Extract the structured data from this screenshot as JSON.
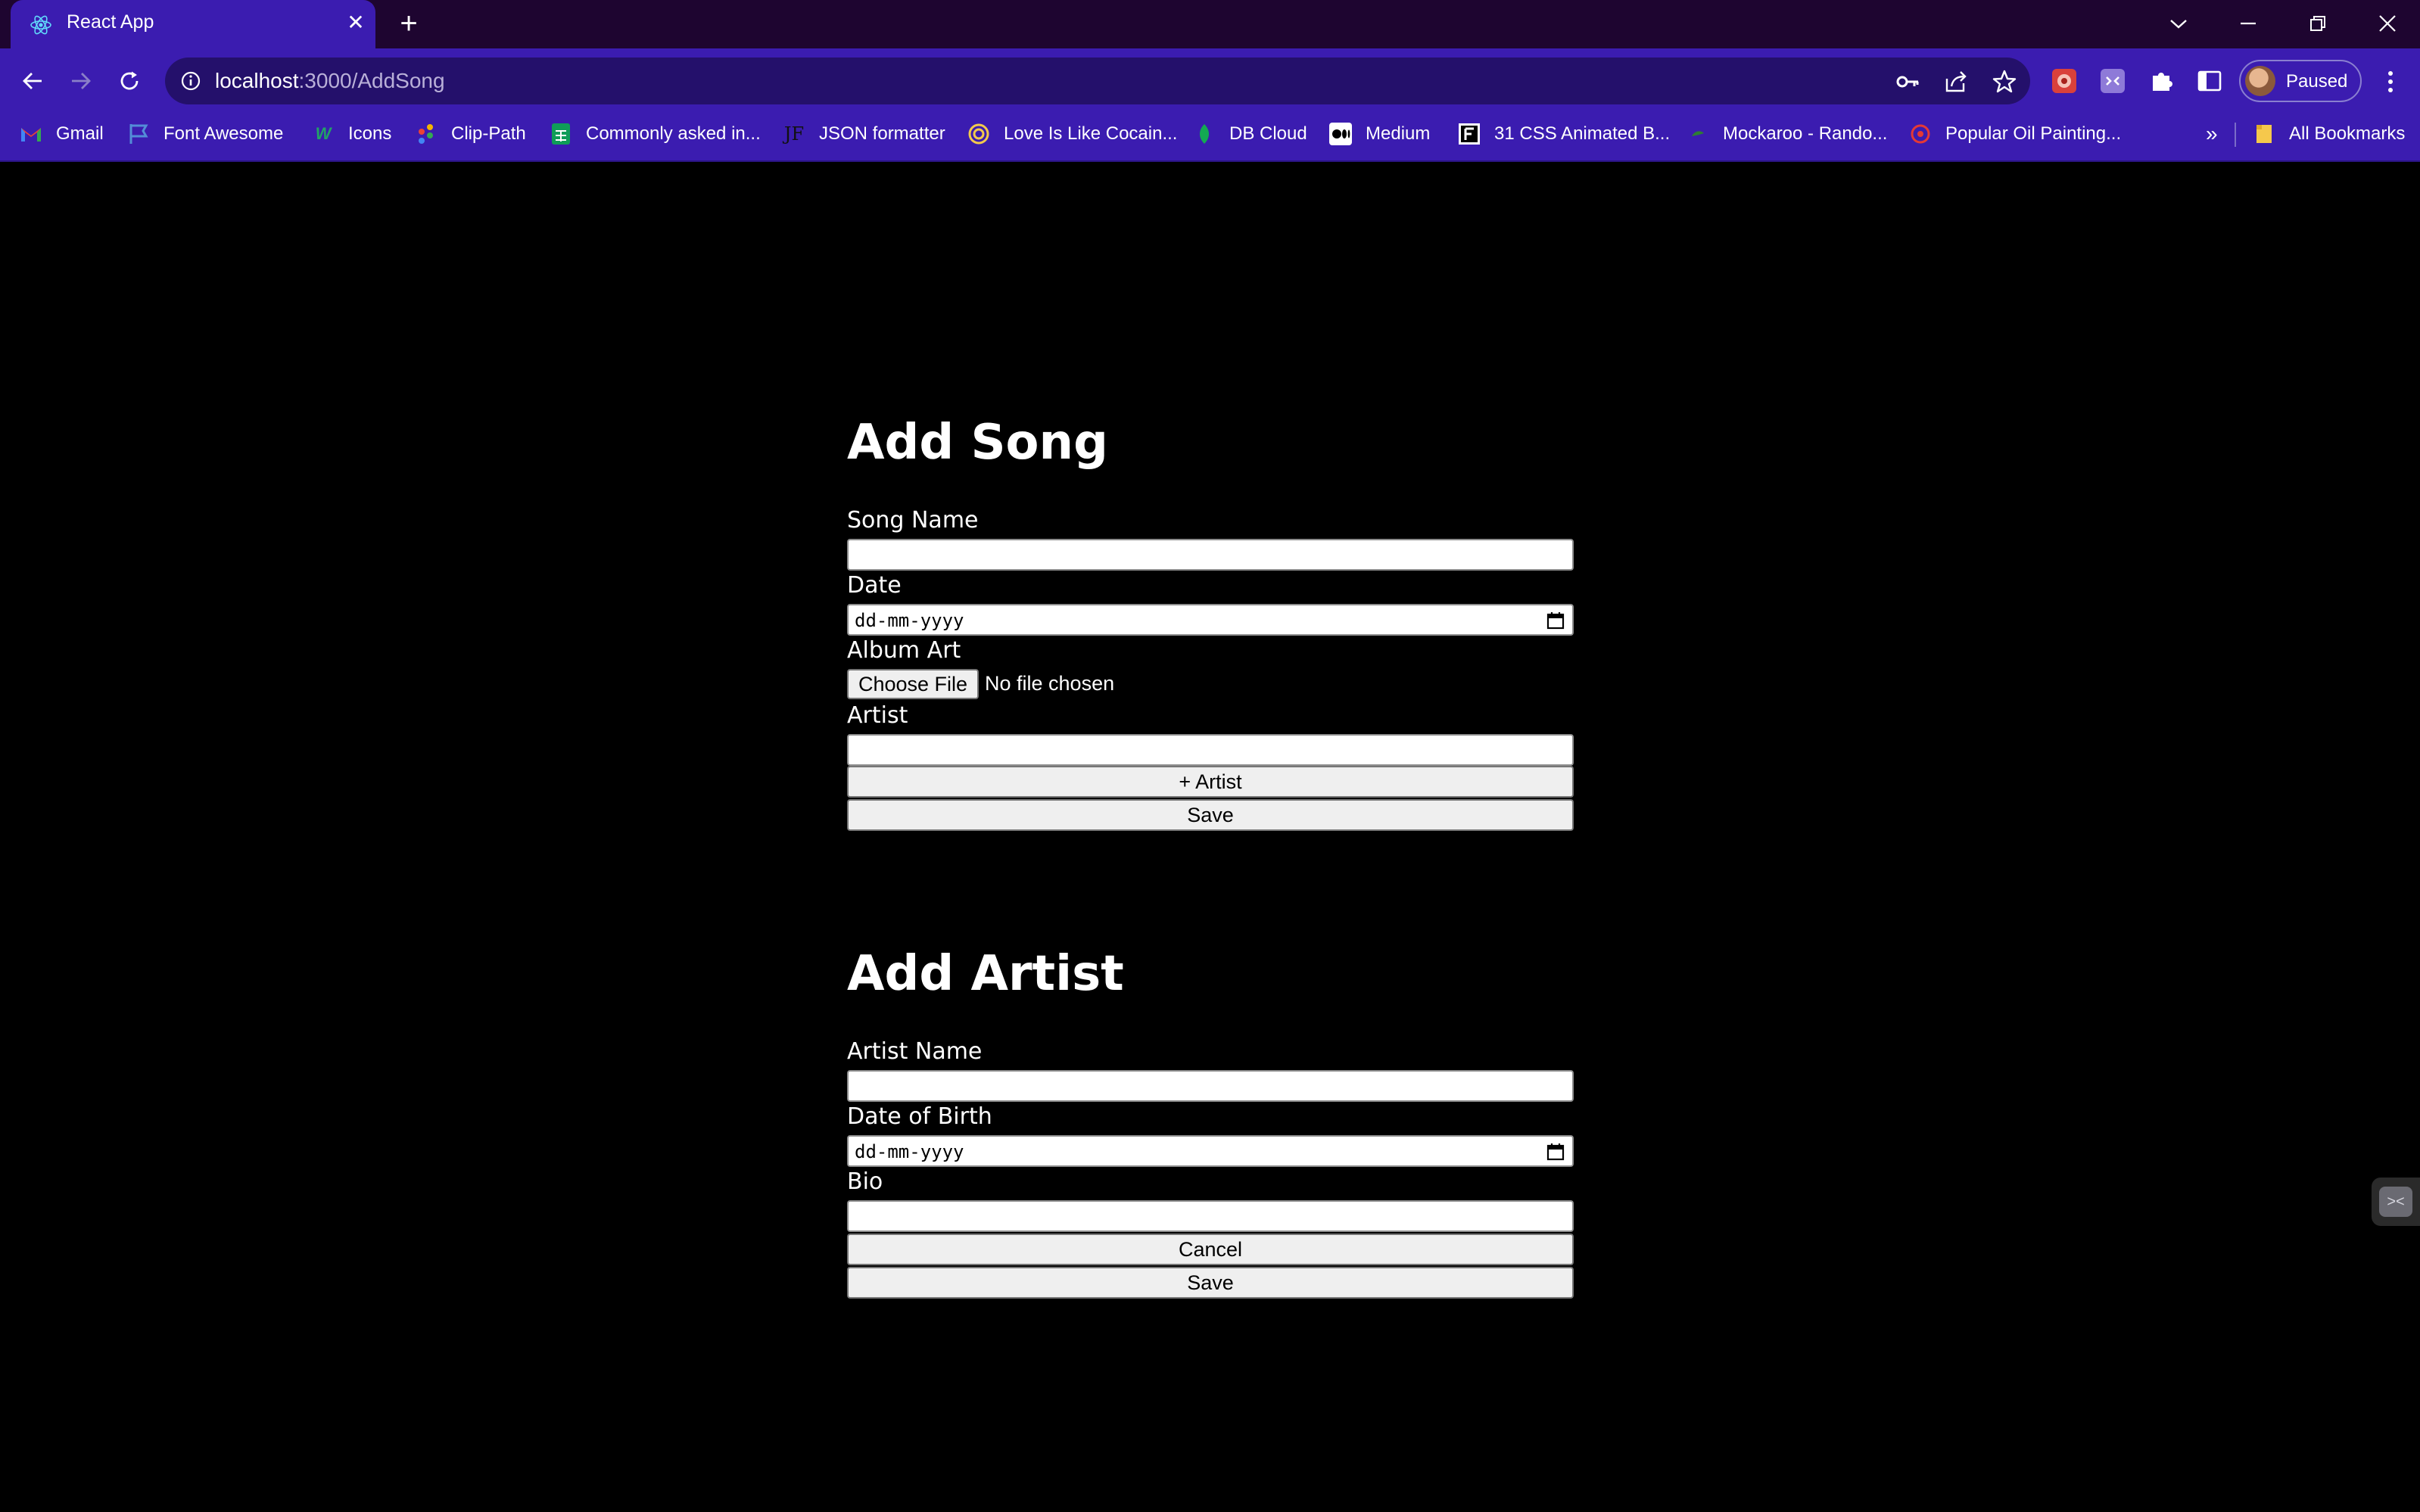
{
  "browser": {
    "tab": {
      "title": "React App",
      "favicon": "react-logo-icon"
    },
    "window_controls": [
      "chevron-down-icon",
      "minimize-icon",
      "restore-icon",
      "close-icon"
    ],
    "address": {
      "host": "localhost",
      "path": ":3000/AddSong"
    },
    "profile": {
      "label": "Paused"
    },
    "bookmarks": [
      {
        "label": "Gmail",
        "icon": "gmail-icon",
        "color": "#ea4335"
      },
      {
        "label": "Font Awesome",
        "icon": "flag-icon",
        "color": "#538dd7"
      },
      {
        "label": "Icons",
        "icon": "w-icon",
        "color": "#21a366"
      },
      {
        "label": "Clip-Path",
        "icon": "dots-icon",
        "color": "#f4b400"
      },
      {
        "label": "Commonly asked in...",
        "icon": "sheets-icon",
        "color": "#0f9d58"
      },
      {
        "label": "JSON formatter",
        "icon": "jf-icon",
        "color": "#111111"
      },
      {
        "label": "Love Is Like Cocain...",
        "icon": "spiral-icon",
        "color": "#f2c94c"
      },
      {
        "label": "DB Cloud",
        "icon": "leaf-icon",
        "color": "#13aa52"
      },
      {
        "label": "Medium",
        "icon": "medium-icon",
        "color": "#ffffff"
      },
      {
        "label": "31 CSS Animated B...",
        "icon": "f-icon",
        "color": "#ffffff"
      },
      {
        "label": "Mockaroo - Rando...",
        "icon": "mockaroo-icon",
        "color": "#2e7d32"
      },
      {
        "label": "Popular Oil Painting...",
        "icon": "painting-icon",
        "color": "#e53935"
      }
    ],
    "bookmarks_overflow": "»",
    "all_bookmarks": "All Bookmarks"
  },
  "add_song": {
    "title": "Add Song",
    "song_name_label": "Song Name",
    "song_name_value": "",
    "date_label": "Date",
    "date_placeholder": "dd-mm-yyyy",
    "album_art_label": "Album Art",
    "choose_file": "Choose File",
    "file_status": "No file chosen",
    "artist_label": "Artist",
    "artist_value": "",
    "add_artist_button": "+ Artist",
    "save_button": "Save"
  },
  "add_artist": {
    "title": "Add Artist",
    "artist_name_label": "Artist Name",
    "artist_name_value": "",
    "dob_label": "Date of Birth",
    "dob_placeholder": "dd-mm-yyyy",
    "bio_label": "Bio",
    "bio_value": "",
    "cancel_button": "Cancel",
    "save_button": "Save"
  },
  "colors": {
    "tabstrip": "#1e0530",
    "toolbar": "#3b1cb0",
    "omnibox": "#24106b",
    "page_background": "#000000",
    "text": "#ffffff"
  }
}
